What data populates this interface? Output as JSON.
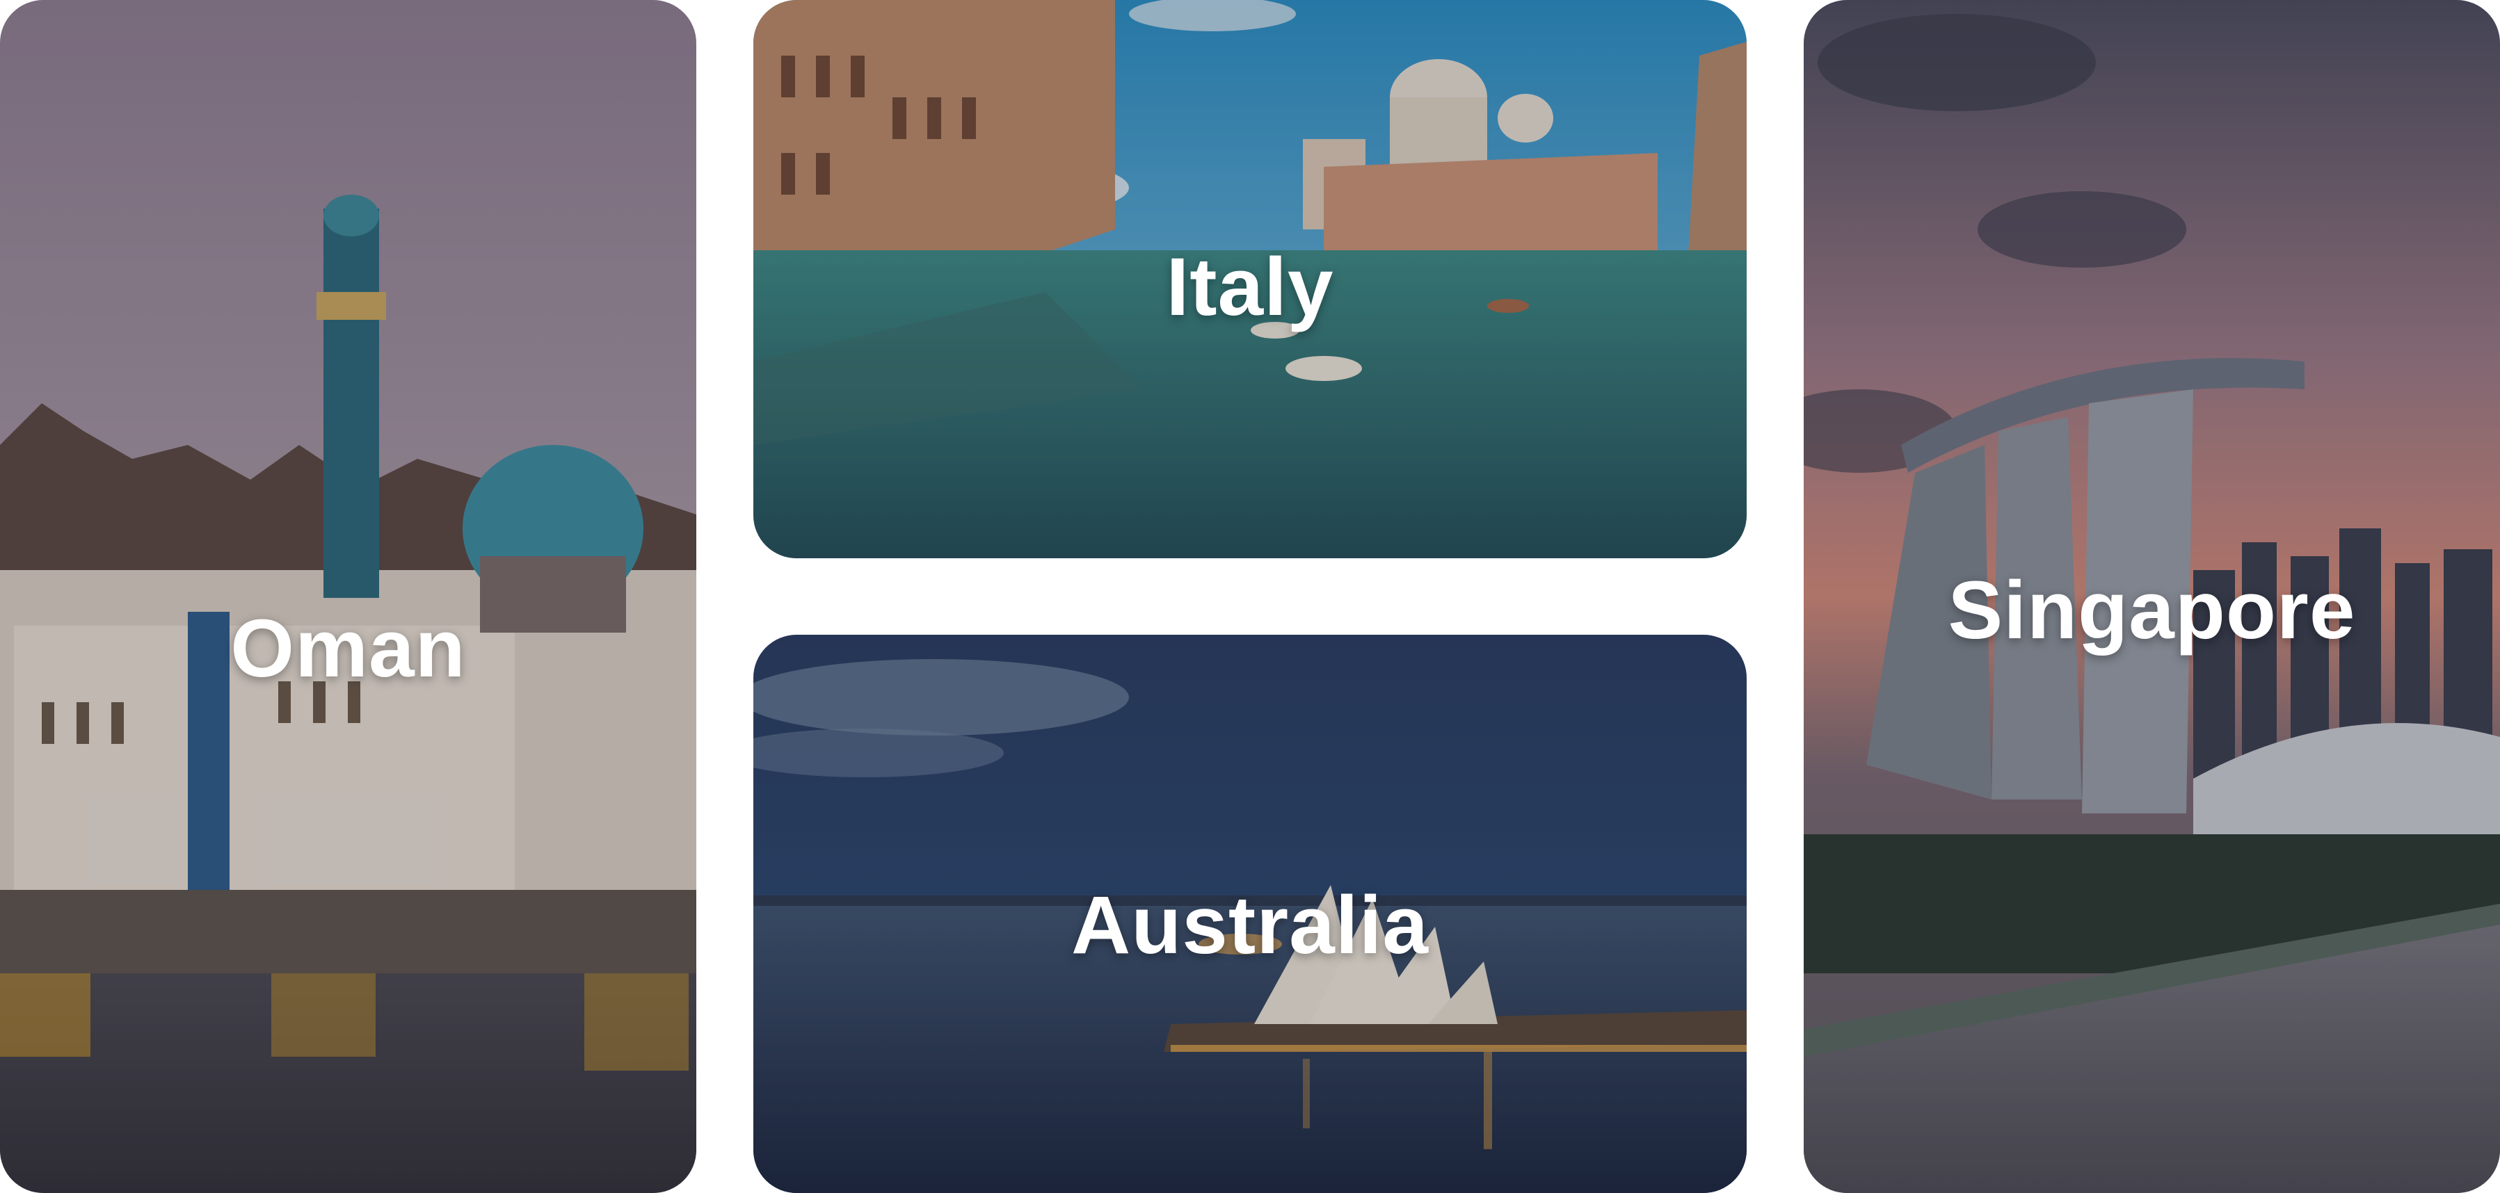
{
  "destinations": [
    {
      "name": "Oman"
    },
    {
      "name": "Italy"
    },
    {
      "name": "Australia"
    },
    {
      "name": "Singapore"
    }
  ]
}
